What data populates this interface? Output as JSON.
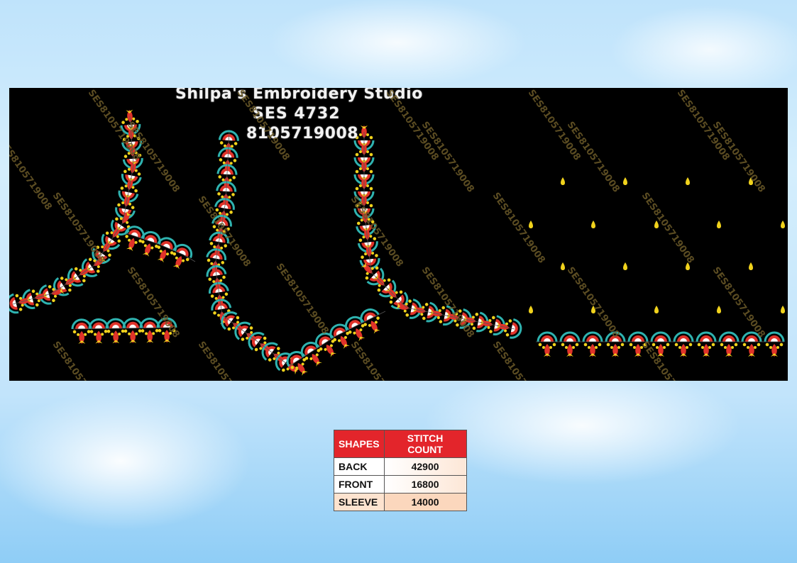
{
  "studio": {
    "name": "Shilpa's Embroidery Studio",
    "design_code": "SES 4732",
    "phone": "8105719008"
  },
  "watermark": "SES8105719008",
  "table": {
    "headers": [
      "SHAPES",
      "STITCH COUNT"
    ],
    "rows": [
      {
        "shape": "BACK",
        "count": "42900"
      },
      {
        "shape": "FRONT",
        "count": "16800"
      },
      {
        "shape": "SLEEVE",
        "count": "14000"
      }
    ]
  },
  "colors": {
    "board_background": "#000000",
    "scallop_teal": "#2fb3b0",
    "motif_red": "#e0332a",
    "motif_yellow": "#f0d21c",
    "header_red": "#e3252b"
  }
}
